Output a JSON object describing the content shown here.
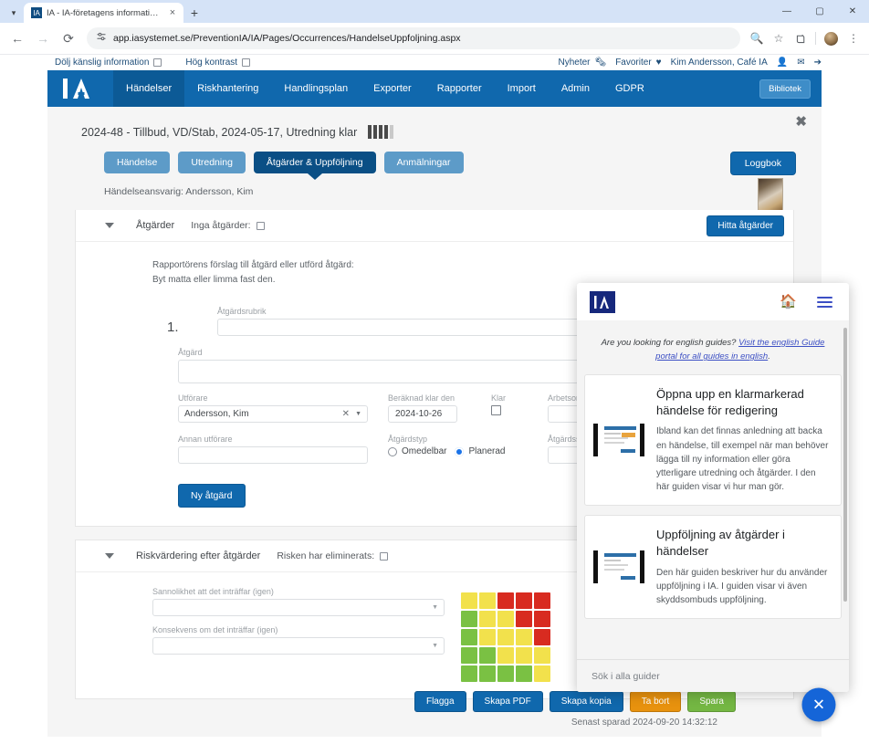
{
  "browser": {
    "tab": {
      "title": "IA - IA-företagens information:",
      "favicon": "ia-logo-icon",
      "close": "×"
    },
    "new_tab": "+",
    "window": {
      "minimize": "—",
      "maximize": "▢",
      "close": "✕"
    },
    "nav": {
      "back": "←",
      "forward": "→",
      "reload": "⟳"
    },
    "url": "app.iasystemet.se/PreventionIA/IA/Pages/Occurrences/HandelseUppfoljning.aspx",
    "omni_icons": {
      "site": "tune-icon",
      "zoom": "🔍",
      "bookmark": "☆",
      "extensions": "⊞",
      "menu": "⋮"
    }
  },
  "app_topbar": {
    "hide_sensitive_label": "Dölj känslig information",
    "high_contrast_label": "Hög kontrast",
    "news_label": "Nyheter",
    "favorites_label": "Favoriter",
    "user_label": "Kim Andersson, Café IA"
  },
  "main_nav": {
    "logo": "ia-logo-icon",
    "items": [
      {
        "label": "Händelser",
        "active": true
      },
      {
        "label": "Riskhantering",
        "active": false
      },
      {
        "label": "Handlingsplan",
        "active": false
      },
      {
        "label": "Exporter",
        "active": false
      },
      {
        "label": "Rapporter",
        "active": false
      },
      {
        "label": "Import",
        "active": false
      },
      {
        "label": "Admin",
        "active": false
      },
      {
        "label": "GDPR",
        "active": false
      }
    ],
    "library_button": "Bibliotek"
  },
  "case": {
    "title": "2024-48 - Tillbud, VD/Stab, 2024-05-17, Utredning klar",
    "close": "✖",
    "tabs": [
      {
        "label": "Händelse",
        "active": false
      },
      {
        "label": "Utredning",
        "active": false
      },
      {
        "label": "Åtgärder & Uppföljning",
        "active": true
      },
      {
        "label": "Anmälningar",
        "active": false
      }
    ],
    "logbook_button": "Loggbok",
    "responsible": "Händelseansvarig: Andersson, Kim"
  },
  "actions_panel": {
    "header_title": "Åtgärder",
    "no_actions_label": "Inga åtgärder:",
    "find_actions_button": "Hitta åtgärder",
    "reporter_note_line1": "Rapportörens förslag till åtgärd eller utförd åtgärd:",
    "reporter_note_line2": "Byt matta eller limma fast den.",
    "action": {
      "number": "1.",
      "rubrik_label": "Åtgärdsrubrik",
      "rubrik_value": "",
      "atgard_label": "Åtgärd",
      "atgard_value": "",
      "utforare_label": "Utförare",
      "utforare_value": "Andersson, Kim",
      "utforare_clear": "✕",
      "utforare_caret": "▼",
      "berkand_label": "Beräknad klar den",
      "berkand_value": "2024-10-26",
      "klar_label": "Klar",
      "arbetsorder_label": "Arbetsordern",
      "arbetsorder_value": "",
      "annan_label": "Annan utförare",
      "annan_value": "",
      "atgardstyp_label": "Åtgärdstyp",
      "atgardstyp_options": [
        {
          "label": "Omedelbar",
          "selected": false
        },
        {
          "label": "Planerad",
          "selected": true
        }
      ],
      "atgardssteg_label": "Åtgärdssteg",
      "atgardssteg_value": ""
    },
    "new_action_button": "Ny åtgärd"
  },
  "risk_panel": {
    "header_title": "Riskvärdering efter åtgärder",
    "eliminated_label": "Risken har eliminerats:",
    "probability_label": "Sannolikhet att det inträffar (igen)",
    "probability_value": "",
    "consequence_label": "Konsekvens om det inträffar (igen)",
    "consequence_value": "",
    "matrix_caret": "▼"
  },
  "risk_matrix": {
    "colors": {
      "green": "#7ac143",
      "yellow": "#f2e14c",
      "red": "#d82b20"
    },
    "rows": [
      [
        "yellow",
        "yellow",
        "red",
        "red",
        "red"
      ],
      [
        "green",
        "yellow",
        "yellow",
        "red",
        "red"
      ],
      [
        "green",
        "yellow",
        "yellow",
        "yellow",
        "red"
      ],
      [
        "green",
        "green",
        "yellow",
        "yellow",
        "yellow"
      ],
      [
        "green",
        "green",
        "green",
        "green",
        "yellow"
      ]
    ]
  },
  "footer": {
    "buttons": [
      {
        "label": "Flagga",
        "style": "blue"
      },
      {
        "label": "Skapa PDF",
        "style": "blue"
      },
      {
        "label": "Skapa kopia",
        "style": "blue"
      },
      {
        "label": "Ta bort",
        "style": "orange"
      },
      {
        "label": "Spara",
        "style": "green"
      }
    ],
    "saved_text": "Senast sparad 2024-09-20 14:32:12"
  },
  "guide_panel": {
    "logo": "ia-logo-icon",
    "home_icon": "home-icon",
    "menu_icon": "hamburger-menu-icon",
    "intro_prefix": "Are you looking for english guides? ",
    "intro_link": "Visit the english Guide portal for all guides in english",
    "intro_suffix": ".",
    "cards": [
      {
        "title": "Öppna upp en klarmarkerad händelse för redigering",
        "desc": "Ibland kan det finnas anledning att backa en händelse, till exempel när man behöver lägga till ny information eller göra ytterligare utredning och åtgärder. I den här guiden visar vi hur man gör."
      },
      {
        "title": "Uppföljning av åtgärder i händelser",
        "desc": "Den här guiden beskriver hur du använder uppföljning i IA. I guiden visar vi även skyddsombuds uppföljning."
      }
    ],
    "search_placeholder": "Sök i alla guider",
    "close_fab": "✕"
  }
}
